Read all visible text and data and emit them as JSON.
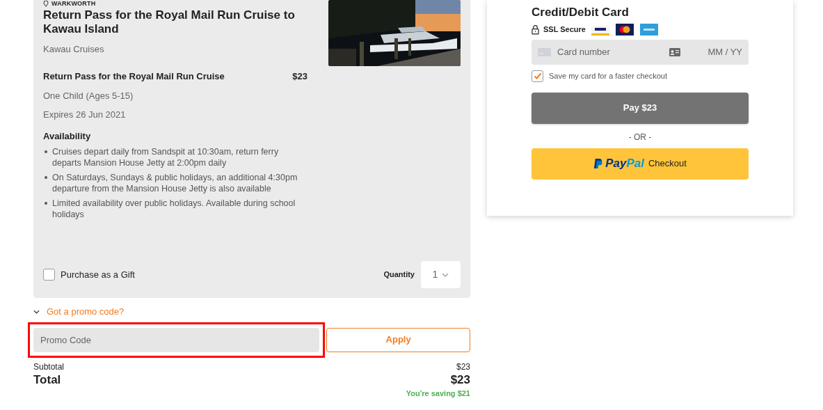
{
  "product": {
    "location": "WARKWORTH",
    "title": "Return Pass for the Royal Mail Run Cruise to Kawau Island",
    "operator": "Kawau Cruises",
    "option_name": "Return Pass for the Royal Mail Run Cruise",
    "option_price": "$23",
    "ticket_type": "One Child (Ages 5-15)",
    "expiry": "Expires 26 Jun 2021",
    "availability_heading": "Availability",
    "availability": [
      "Cruises depart daily from Sandspit at 10:30am, return ferry departs Mansion House Jetty at 2:00pm daily",
      "On Saturdays, Sundays & public holidays, an additional 4:30pm departure from the Mansion House Jetty is also available",
      "Limited availability over public holidays. Available during school holidays"
    ],
    "gift": {
      "label": "Purchase as a Gift",
      "checked": false
    },
    "quantity": {
      "label": "Quantity",
      "value": "1"
    }
  },
  "promo": {
    "toggle": "Got a promo code?",
    "expanded": true,
    "placeholder": "Promo Code",
    "apply": "Apply",
    "highlighted": true
  },
  "totals": {
    "subtotal_label": "Subtotal",
    "subtotal": "$23",
    "total_label": "Total",
    "total": "$23",
    "saving": "You're saving $21"
  },
  "payment": {
    "title": "Credit/Debit Card",
    "secure": "SSL Secure",
    "card_placeholder": "Card number",
    "expiry_placeholder": "MM / YY",
    "save_card": {
      "label": "Save my card for a faster checkout",
      "checked": true
    },
    "pay": "Pay $23",
    "or": "- OR -",
    "paypal_a": "Pay",
    "paypal_b": "Pal",
    "paypal_checkout": "Checkout"
  }
}
